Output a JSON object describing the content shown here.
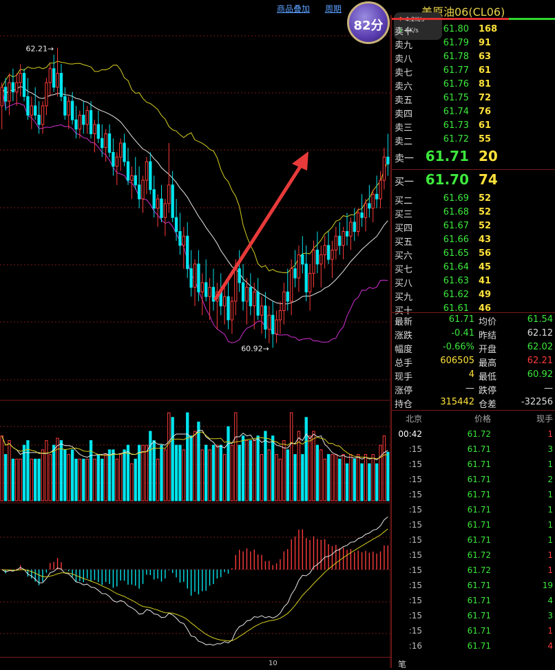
{
  "header": {
    "link1": "商品叠加",
    "link2": "周期",
    "title": "美原油06(CL06)"
  },
  "badge": {
    "score": "82分",
    "up_speed": "4.2K/s",
    "down_speed": "6K/s"
  },
  "colors": {
    "up": "#ff3b3b",
    "down": "#00e5ee",
    "green": "#3ce83c",
    "yellow": "#ffe23a",
    "grid": "#7a1a1a"
  },
  "order_book": {
    "asks": [
      {
        "label": "卖十",
        "price": "61.80",
        "vol": "168"
      },
      {
        "label": "卖九",
        "price": "61.79",
        "vol": "91"
      },
      {
        "label": "卖八",
        "price": "61.78",
        "vol": "63"
      },
      {
        "label": "卖七",
        "price": "61.77",
        "vol": "61"
      },
      {
        "label": "卖六",
        "price": "61.76",
        "vol": "81"
      },
      {
        "label": "卖五",
        "price": "61.75",
        "vol": "72"
      },
      {
        "label": "卖四",
        "price": "61.74",
        "vol": "76"
      },
      {
        "label": "卖三",
        "price": "61.73",
        "vol": "61"
      },
      {
        "label": "卖二",
        "price": "61.72",
        "vol": "55"
      },
      {
        "label": "卖一",
        "price": "61.71",
        "vol": "20"
      }
    ],
    "bids": [
      {
        "label": "买一",
        "price": "61.70",
        "vol": "74"
      },
      {
        "label": "买二",
        "price": "61.69",
        "vol": "52"
      },
      {
        "label": "买三",
        "price": "61.68",
        "vol": "52"
      },
      {
        "label": "买四",
        "price": "61.67",
        "vol": "52"
      },
      {
        "label": "买五",
        "price": "61.66",
        "vol": "43"
      },
      {
        "label": "买六",
        "price": "61.65",
        "vol": "56"
      },
      {
        "label": "买七",
        "price": "61.64",
        "vol": "45"
      },
      {
        "label": "买八",
        "price": "61.63",
        "vol": "41"
      },
      {
        "label": "买九",
        "price": "61.62",
        "vol": "49"
      },
      {
        "label": "买十",
        "price": "61.61",
        "vol": "46"
      }
    ]
  },
  "stats": [
    {
      "l1": "最新",
      "v1": "61.71",
      "c1": "green",
      "l2": "均价",
      "v2": "61.54",
      "c2": "green"
    },
    {
      "l1": "涨跌",
      "v1": "-0.41",
      "c1": "green",
      "l2": "昨结",
      "v2": "62.12",
      "c2": "white"
    },
    {
      "l1": "幅度",
      "v1": "-0.66%",
      "c1": "green",
      "l2": "开盘",
      "v2": "62.02",
      "c2": "green"
    },
    {
      "l1": "总手",
      "v1": "606505",
      "c1": "yellow",
      "l2": "最高",
      "v2": "62.21",
      "c2": "red"
    },
    {
      "l1": "现手",
      "v1": "4",
      "c1": "yellow",
      "l2": "最低",
      "v2": "60.92",
      "c2": "green"
    },
    {
      "l1": "涨停",
      "v1": "—",
      "c1": "white",
      "l2": "跌停",
      "v2": "—",
      "c2": "white"
    },
    {
      "l1": "持仓",
      "v1": "315442",
      "c1": "yellow",
      "l2": "仓差",
      "v2": "-32256",
      "c2": "white"
    }
  ],
  "ticks_header": {
    "time": "北京",
    "price": "价格",
    "vol": "现手"
  },
  "ticks": [
    {
      "time": "00:42",
      "price": "61.72",
      "vol": "1",
      "vc": "red"
    },
    {
      "time": ":15",
      "price": "61.71",
      "vol": "3",
      "vc": "green"
    },
    {
      "time": ":15",
      "price": "61.71",
      "vol": "1",
      "vc": "green"
    },
    {
      "time": ":15",
      "price": "61.71",
      "vol": "2",
      "vc": "green"
    },
    {
      "time": ":15",
      "price": "61.71",
      "vol": "1",
      "vc": "green"
    },
    {
      "time": ":15",
      "price": "61.71",
      "vol": "1",
      "vc": "green"
    },
    {
      "time": ":15",
      "price": "61.71",
      "vol": "1",
      "vc": "green"
    },
    {
      "time": ":15",
      "price": "61.71",
      "vol": "1",
      "vc": "green"
    },
    {
      "time": ":15",
      "price": "61.72",
      "vol": "1",
      "vc": "red"
    },
    {
      "time": ":15",
      "price": "61.72",
      "vol": "1",
      "vc": "red"
    },
    {
      "time": ":15",
      "price": "61.71",
      "vol": "19",
      "vc": "green"
    },
    {
      "time": ":15",
      "price": "61.71",
      "vol": "4",
      "vc": "green"
    },
    {
      "time": ":15",
      "price": "61.71",
      "vol": "3",
      "vc": "green"
    },
    {
      "time": ":15",
      "price": "61.71",
      "vol": "1",
      "vc": "red"
    },
    {
      "time": ":16",
      "price": "61.71",
      "vol": "4",
      "vc": "red"
    }
  ],
  "footer": {
    "tab": "笔",
    "x_label": "10"
  },
  "chart_data": {
    "type": "candlestick",
    "price_range": [
      60.92,
      62.21
    ],
    "annotations": [
      {
        "text": "62.21→",
        "price": 62.21,
        "bar": 15
      },
      {
        "text": "60.92→",
        "price": 60.92,
        "bar": 73
      }
    ],
    "bars": [
      [
        61.96,
        62.06,
        61.86,
        62.04
      ],
      [
        62.04,
        62.08,
        61.94,
        61.98
      ],
      [
        61.98,
        62.1,
        61.92,
        62.06
      ],
      [
        62.06,
        62.12,
        61.98,
        62.02
      ],
      [
        62.02,
        62.1,
        61.96,
        62.06
      ],
      [
        62.06,
        62.14,
        62.0,
        62.1
      ],
      [
        62.1,
        62.12,
        61.98,
        62.0
      ],
      [
        62.0,
        62.08,
        61.9,
        61.92
      ],
      [
        61.92,
        62.0,
        61.86,
        61.96
      ],
      [
        61.96,
        62.04,
        61.9,
        61.92
      ],
      [
        61.92,
        61.98,
        61.84,
        61.88
      ],
      [
        61.88,
        61.98,
        61.84,
        61.96
      ],
      [
        61.96,
        62.08,
        61.92,
        62.06
      ],
      [
        62.06,
        62.14,
        62.0,
        62.12
      ],
      [
        62.12,
        62.18,
        62.02,
        62.04
      ],
      [
        62.04,
        62.21,
        62.0,
        62.1
      ],
      [
        62.1,
        62.14,
        61.98,
        62.0
      ],
      [
        62.0,
        62.04,
        61.9,
        61.92
      ],
      [
        61.92,
        62.0,
        61.86,
        61.98
      ],
      [
        61.98,
        62.02,
        61.88,
        61.9
      ],
      [
        61.9,
        61.96,
        61.82,
        61.86
      ],
      [
        61.86,
        61.94,
        61.82,
        61.92
      ],
      [
        61.92,
        61.98,
        61.84,
        61.88
      ],
      [
        61.88,
        61.96,
        61.84,
        61.94
      ],
      [
        61.94,
        61.98,
        61.82,
        61.84
      ],
      [
        61.84,
        61.9,
        61.76,
        61.88
      ],
      [
        61.88,
        61.94,
        61.8,
        61.82
      ],
      [
        61.82,
        61.88,
        61.74,
        61.78
      ],
      [
        61.78,
        61.86,
        61.72,
        61.84
      ],
      [
        61.84,
        61.88,
        61.74,
        61.76
      ],
      [
        61.76,
        61.82,
        61.66,
        61.7
      ],
      [
        61.7,
        61.76,
        61.62,
        61.74
      ],
      [
        61.74,
        61.82,
        61.68,
        61.8
      ],
      [
        61.8,
        61.84,
        61.7,
        61.72
      ],
      [
        61.72,
        61.78,
        61.62,
        61.64
      ],
      [
        61.64,
        61.7,
        61.56,
        61.66
      ],
      [
        61.66,
        61.74,
        61.6,
        61.62
      ],
      [
        61.62,
        61.7,
        61.52,
        61.56
      ],
      [
        61.56,
        61.66,
        61.5,
        61.64
      ],
      [
        61.64,
        61.74,
        61.58,
        61.72
      ],
      [
        61.72,
        61.76,
        61.58,
        61.6
      ],
      [
        61.6,
        61.66,
        61.48,
        61.52
      ],
      [
        61.52,
        61.58,
        61.44,
        61.56
      ],
      [
        61.56,
        61.62,
        61.46,
        61.48
      ],
      [
        61.48,
        61.56,
        61.4,
        61.54
      ],
      [
        61.54,
        61.8,
        61.5,
        61.62
      ],
      [
        61.62,
        61.68,
        61.46,
        61.48
      ],
      [
        61.48,
        61.56,
        61.38,
        61.42
      ],
      [
        61.42,
        61.5,
        61.32,
        61.36
      ],
      [
        61.36,
        61.44,
        61.26,
        61.4
      ],
      [
        61.4,
        61.46,
        61.22,
        61.26
      ],
      [
        61.26,
        61.34,
        61.14,
        61.18
      ],
      [
        61.18,
        61.3,
        61.1,
        61.28
      ],
      [
        61.28,
        61.34,
        61.12,
        61.16
      ],
      [
        61.16,
        61.24,
        61.06,
        61.2
      ],
      [
        61.2,
        61.3,
        61.12,
        61.14
      ],
      [
        61.14,
        61.22,
        61.04,
        61.18
      ],
      [
        61.18,
        61.26,
        61.08,
        61.12
      ],
      [
        61.12,
        61.2,
        61.0,
        61.16
      ],
      [
        61.16,
        61.24,
        61.06,
        61.1
      ],
      [
        61.1,
        61.18,
        61.02,
        61.14
      ],
      [
        61.14,
        61.22,
        61.0,
        61.04
      ],
      [
        61.04,
        61.14,
        60.98,
        61.12
      ],
      [
        61.12,
        61.3,
        61.06,
        61.26
      ],
      [
        61.26,
        61.34,
        61.16,
        61.2
      ],
      [
        61.2,
        61.28,
        61.08,
        61.12
      ],
      [
        61.12,
        61.22,
        61.02,
        61.18
      ],
      [
        61.18,
        61.24,
        61.06,
        61.1
      ],
      [
        61.1,
        61.2,
        61.0,
        61.16
      ],
      [
        61.16,
        61.22,
        61.04,
        61.06
      ],
      [
        61.06,
        61.14,
        60.98,
        61.1
      ],
      [
        61.1,
        61.16,
        60.96,
        61.0
      ],
      [
        61.0,
        61.1,
        60.94,
        61.06
      ],
      [
        61.06,
        61.12,
        60.92,
        60.98
      ],
      [
        60.98,
        61.08,
        60.94,
        61.04
      ],
      [
        61.04,
        61.12,
        60.98,
        61.08
      ],
      [
        61.08,
        61.2,
        61.02,
        61.16
      ],
      [
        61.16,
        61.26,
        61.08,
        61.12
      ],
      [
        61.12,
        61.3,
        61.06,
        61.26
      ],
      [
        61.26,
        61.34,
        61.18,
        61.22
      ],
      [
        61.22,
        61.36,
        61.16,
        61.32
      ],
      [
        61.32,
        61.4,
        61.24,
        61.28
      ],
      [
        61.28,
        61.36,
        61.12,
        61.16
      ],
      [
        61.16,
        61.28,
        61.08,
        61.24
      ],
      [
        61.24,
        61.38,
        61.18,
        61.34
      ],
      [
        61.34,
        61.42,
        61.24,
        61.28
      ],
      [
        61.28,
        61.36,
        61.18,
        61.32
      ],
      [
        61.32,
        61.4,
        61.26,
        61.36
      ],
      [
        61.36,
        61.42,
        61.28,
        61.3
      ],
      [
        61.3,
        61.38,
        61.22,
        61.34
      ],
      [
        61.34,
        61.44,
        61.3,
        61.4
      ],
      [
        61.4,
        61.46,
        61.32,
        61.36
      ],
      [
        61.36,
        61.44,
        61.3,
        61.42
      ],
      [
        61.42,
        61.5,
        61.36,
        61.4
      ],
      [
        61.4,
        61.48,
        61.34,
        61.46
      ],
      [
        61.46,
        61.52,
        61.38,
        61.42
      ],
      [
        61.42,
        61.52,
        61.4,
        61.5
      ],
      [
        61.5,
        61.58,
        61.44,
        61.48
      ],
      [
        61.48,
        61.56,
        61.42,
        61.54
      ],
      [
        61.54,
        61.62,
        61.48,
        61.52
      ],
      [
        61.52,
        61.6,
        61.46,
        61.58
      ],
      [
        61.58,
        61.66,
        61.52,
        61.56
      ],
      [
        61.56,
        61.68,
        61.52,
        61.64
      ],
      [
        61.64,
        61.78,
        61.6,
        61.74
      ],
      [
        61.74,
        61.84,
        61.66,
        61.71
      ]
    ]
  }
}
